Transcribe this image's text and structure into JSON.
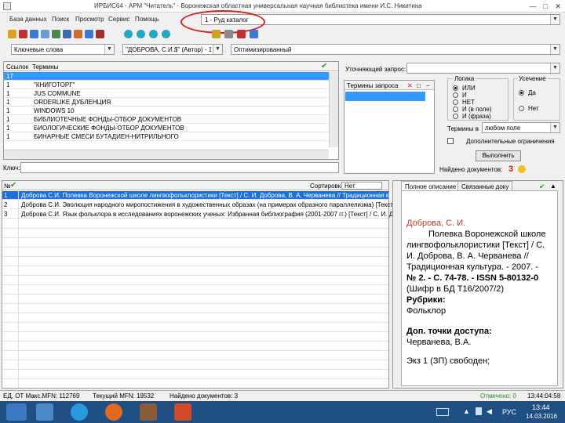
{
  "window": {
    "title": "ИРБИС64 - АРМ \"Читатель\" - Воронежская областная универсальная научная библиотека имени И.С. Никитина",
    "min": "—",
    "max": "□",
    "close": "✕"
  },
  "menu": [
    "База данных",
    "Поиск",
    "Просмотр",
    "Сервис",
    "Помощь"
  ],
  "db_selector": {
    "value": "1 - Руд каталог"
  },
  "search_bar": {
    "mode": "Ключевые слова",
    "author": "\"ДОБРОВА, С.И.$\" (Автор) - 1",
    "view": "Оптимизированный"
  },
  "dictionary": {
    "col_count": "Ссылок",
    "col_term": "Термины",
    "rows": [
      {
        "count": "17",
        "term": ""
      },
      {
        "count": "1",
        "term": "\"КНИГОТОРГ\""
      },
      {
        "count": "1",
        "term": "JUS COMMUNE"
      },
      {
        "count": "1",
        "term": "ORDERLIKE ДУБЛЕНЦИЯ"
      },
      {
        "count": "1",
        "term": "WINDOWS 10"
      },
      {
        "count": "1",
        "term": "БИБЛИОТЕЧНЫЕ ФОНДЫ-ОТБОР ДОКУМЕНТОВ"
      },
      {
        "count": "1",
        "term": "БИОЛОГИЧЕСКИЕ ФОНДЫ-ОТБОР ДОКУМЕНТОВ"
      },
      {
        "count": "1",
        "term": "БИНАРНЫЕ СМЕСИ БУТАДИЕН-НИТРИЛЬНОГО"
      }
    ],
    "key_label": "Ключ:"
  },
  "query": {
    "refine_label": "Уточняющий запрос:",
    "terms_label": "Термины запроса",
    "logic_title": "Логика",
    "logic": [
      "ИЛИ",
      "И",
      "НЕТ",
      "И (в поле)",
      "И (фраза)"
    ],
    "trunc_title": "Усечение",
    "trunc": [
      "Да",
      "Нет"
    ],
    "terms_in_label": "Термины в",
    "terms_in_value": "любом поле",
    "extra_label": "Дополнительные ограничения",
    "run_label": "Выполнить",
    "found_label": "Найдено документов:",
    "found_count": "3"
  },
  "results": {
    "col_no": "№",
    "sort_label": "Сортировка:",
    "sort_value": "Нет",
    "rows": [
      {
        "no": "1",
        "text": "Доброва С.И. Полевка Воронежской школе лингвофольклористики [Текст] / С. И. Доброва, В. А. Черванева // Традиционная культ"
      },
      {
        "no": "2",
        "text": "Доброва С.И. Эволюция народного миропостижения в художественных образах (на примерах образного параллелизма) [Текст] / С. И."
      },
      {
        "no": "3",
        "text": "Доброва С.И. Язык фольклора в исследованиях воронежских ученых: Избранная библиография (2001-2007 гг.) [Текст] / С. И. Доб"
      }
    ]
  },
  "description": {
    "tab_full": "Полное описание",
    "tab_linked": "Связанные доку",
    "author": "Доброва, С. И.",
    "body": "Полевка Воронежской школе лингвофольклористики [Текст] / С. И. Доброва, В. А. Черванева // Традиционная культура. - 2007. -",
    "issue": "№ 2. - С. 74-78. - ISSN 5-80132-0",
    "shelf": "(Шифр в БД Т16/2007/2)",
    "rubrics_label": "Рубрики:",
    "rubric": "Фольклор",
    "access_label": "Доп. точки доступа:",
    "access": "Черванева, В.А.",
    "copies": "Экз 1 (ЗП) свободен;"
  },
  "status": {
    "db": "ЕД, ОТ Макс.MFN: 112769",
    "current": "Текущий MFN: 19532",
    "found": "Найдено документов: 3",
    "marked": "Отмечено: 0",
    "clock": "13:44:04:58"
  },
  "taskbar": {
    "lang": "РУС",
    "time": "13:44",
    "date": "14.03.2016"
  },
  "colors": {
    "selection": "#3399ff",
    "taskbar": "#1f4f83",
    "annotation": "#d42020",
    "link": "#1a3fbf",
    "author_red": "#c0392b"
  }
}
